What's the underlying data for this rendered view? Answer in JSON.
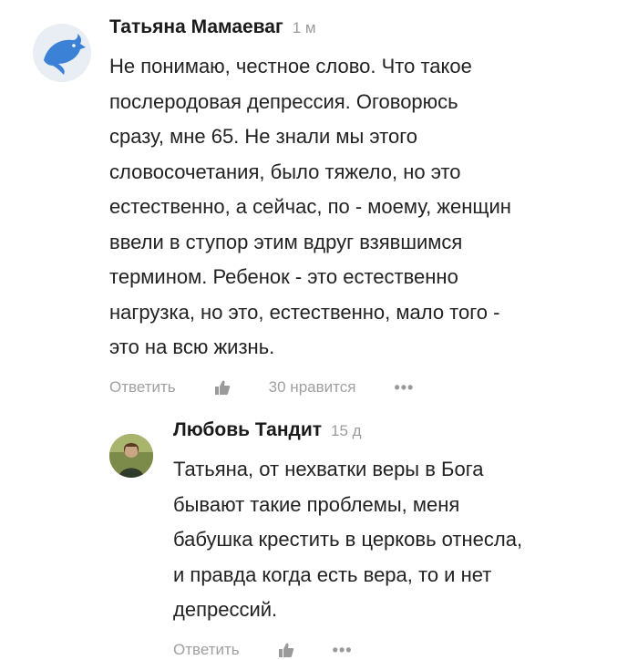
{
  "comments": [
    {
      "author": "Татьяна Мамаеваг",
      "time": "1 м",
      "avatar_icon": "dolphin-icon",
      "text_lines": [
        "Не понимаю, честное слово. Что такое",
        "послеродовая депрессия. Оговорюсь",
        "сразу, мне 65. Не знали мы этого",
        "словосочетания, было тяжело, но это",
        "естественно, а сейчас, по - моему, женщин",
        "ввели в ступор этим вдруг взявшимся",
        "термином. Ребенок - это естественно",
        "нагрузка, но это, естественно, мало того -",
        "это на всю жизнь."
      ],
      "reply_label": "Ответить",
      "likes_label": "30 нравится",
      "more_label": "•••"
    },
    {
      "author": "Любовь Тандит",
      "time": "15 д",
      "avatar_icon": "user-photo-avatar",
      "text_lines": [
        "Татьяна, от нехватки веры в Бога",
        "бывают такие проблемы, меня",
        "бабушка крестить в церковь отнесла,",
        "и правда когда есть вера, то и нет",
        "депрессий."
      ],
      "reply_label": "Ответить",
      "more_label": "•••"
    }
  ],
  "colors": {
    "dolphin": "#3b82d6",
    "muted_text": "#a0a0a0",
    "like_icon": "#999999"
  }
}
